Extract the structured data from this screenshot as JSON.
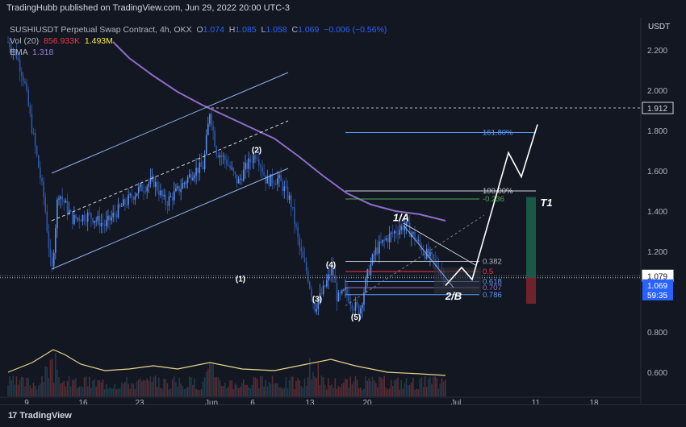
{
  "header": {
    "publish_line": "TradingHubb published on TradingView.com, Jun 29, 2022 20:00 UTC-3"
  },
  "legend": {
    "symbol": "SUSHIUSDT Perpetual Swap Contract, 4h, OKX",
    "o_label": "O",
    "o": "1.074",
    "h_label": "H",
    "h": "1.085",
    "l_label": "L",
    "l": "1.058",
    "c_label": "C",
    "c": "1.069",
    "change": "−0.006 (−0.56%)",
    "vol_label": "Vol (20)",
    "vol_1": "856.933K",
    "vol_2": "1.493M",
    "ema_label": "EMA",
    "ema": "1.318"
  },
  "axis": {
    "currency": "USDT",
    "price_ticks": [
      "2.200",
      "2.000",
      "1.800",
      "1.600",
      "1.400",
      "1.200",
      "1.000",
      "0.800",
      "0.600"
    ],
    "price_values": [
      2.2,
      2.0,
      1.8,
      1.6,
      1.4,
      1.2,
      1.0,
      0.8,
      0.6
    ],
    "time_ticks": [
      "9",
      "16",
      "23",
      "Jun",
      "6",
      "13",
      "20",
      "Jul",
      "11",
      "18"
    ],
    "price_label_1912": "1.912",
    "price_label_1079": "1.079",
    "price_label_1069": "1.069",
    "countdown": "59:35"
  },
  "chart_data": {
    "type": "candlestick",
    "ylim": [
      0.48,
      2.36
    ],
    "annotations": {
      "waves": [
        "(1)",
        "(2)",
        "(3)",
        "(4)",
        "(5)",
        "1/A",
        "2/B",
        "T1"
      ],
      "fib_levels": [
        {
          "label": "161.80%",
          "value": 1.79,
          "color": "#5b9cf6"
        },
        {
          "label": "100.00%",
          "value": 1.5,
          "color": "#d1d4dc"
        },
        {
          "label": "-0.236",
          "value": 1.46,
          "color": "#4caf50"
        },
        {
          "label": "0.382",
          "value": 1.15,
          "color": "#b2b5be"
        },
        {
          "label": "0.5",
          "value": 1.1,
          "color": "#f23645"
        },
        {
          "label": "0.618",
          "value": 1.05,
          "color": "#5b9cf6"
        },
        {
          "label": "0.707",
          "value": 1.02,
          "color": "#9575cd"
        },
        {
          "label": "0.786",
          "value": 0.985,
          "color": "#5b9cf6"
        }
      ]
    },
    "key_levels": [
      1.912,
      1.079,
      1.069
    ]
  },
  "footer": {
    "brand": "TradingView"
  }
}
